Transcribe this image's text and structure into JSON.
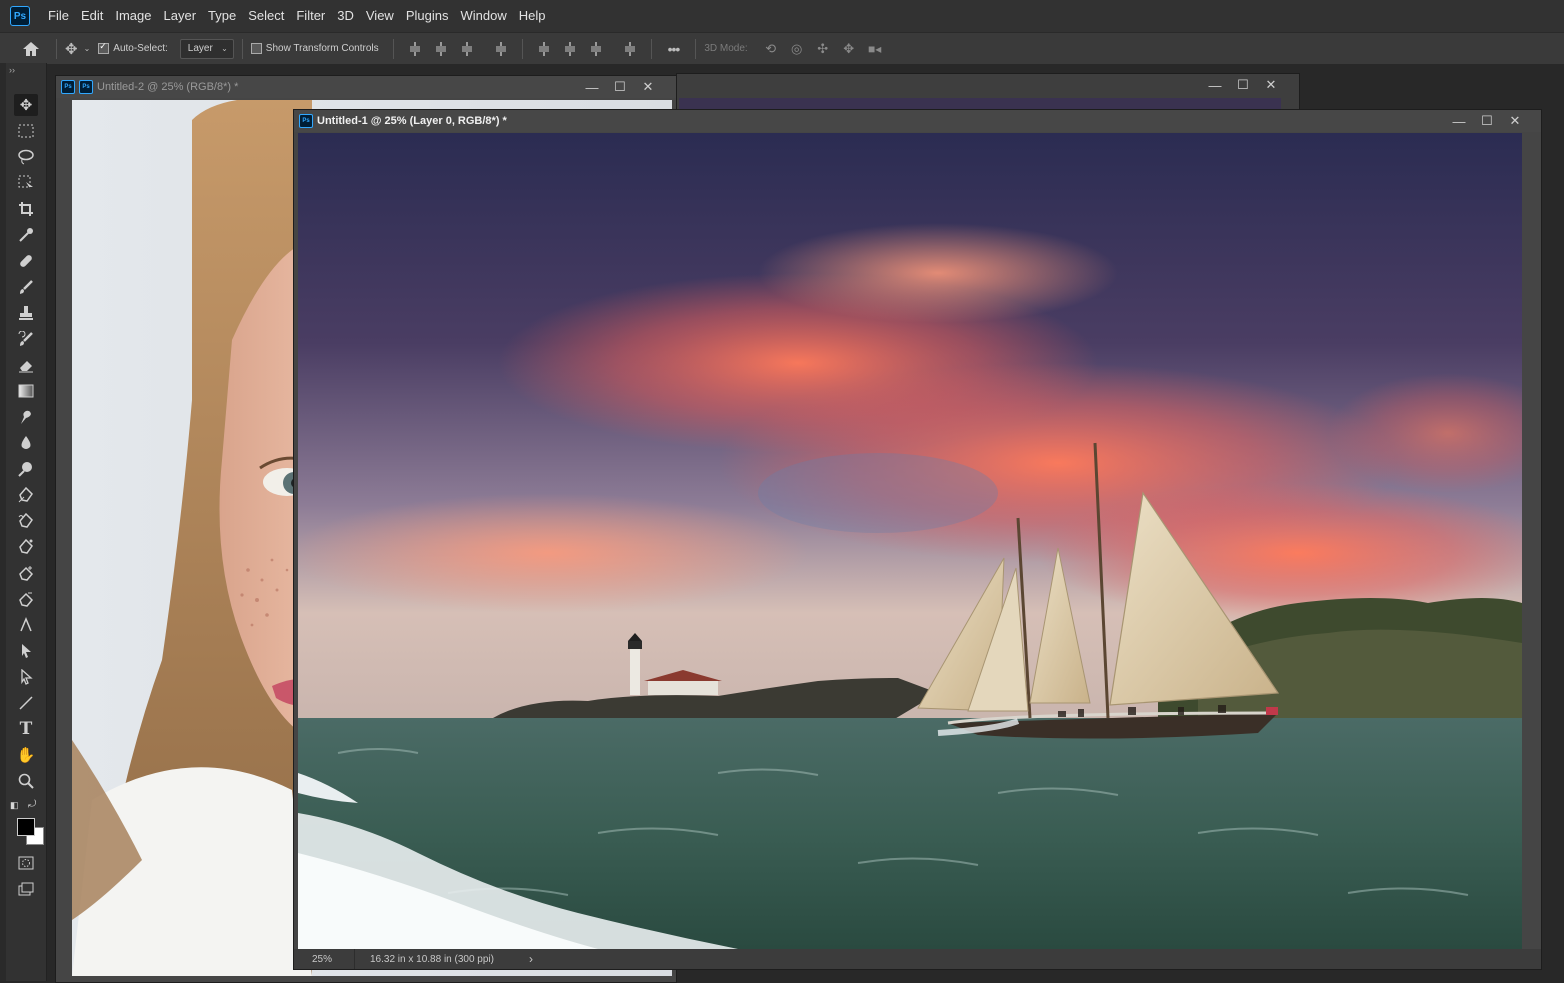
{
  "app": {
    "logo": "Ps"
  },
  "menu": [
    "File",
    "Edit",
    "Image",
    "Layer",
    "Type",
    "Select",
    "Filter",
    "3D",
    "View",
    "Plugins",
    "Window",
    "Help"
  ],
  "options": {
    "auto_select_label": "Auto-Select:",
    "auto_select_checked": true,
    "auto_select_target": "Layer",
    "show_transform_label": "Show Transform Controls",
    "show_transform_checked": false,
    "mode_label": "3D Mode:"
  },
  "tools": [
    "move-tool",
    "marquee-tool",
    "lasso-tool",
    "object-select-tool",
    "crop-tool",
    "eyedropper-tool",
    "healing-brush-tool",
    "brush-tool",
    "clone-stamp-tool",
    "history-brush-tool",
    "eraser-tool",
    "gradient-tool",
    "smudge-tool",
    "blur-tool",
    "dodge-tool",
    "pen-tool",
    "freeform-pen-tool",
    "curvature-pen-tool",
    "add-anchor-tool",
    "delete-anchor-tool",
    "convert-point-tool",
    "path-selection-tool",
    "direct-selection-tool",
    "line-tool",
    "type-tool",
    "hand-tool",
    "zoom-tool"
  ],
  "colors": {
    "foreground": "#000000",
    "background": "#ffffff",
    "accent": "#31a8ff"
  },
  "documents": {
    "back": {
      "title": "Untitled-2 @ 25% (RGB/8*) *"
    },
    "front": {
      "title": "Untitled-1 @ 25% (Layer 0, RGB/8*) *",
      "zoom": "25%",
      "doc_info": "16.32 in x 10.88 in (300 ppi)"
    }
  }
}
